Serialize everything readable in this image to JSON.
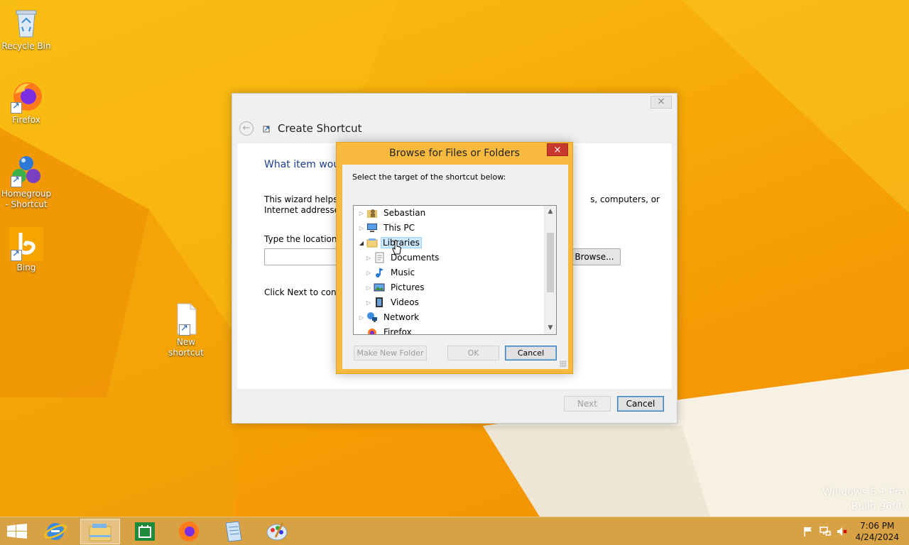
{
  "desktop": {
    "icons": [
      {
        "label": "Recycle Bin"
      },
      {
        "label": "Firefox"
      },
      {
        "label": "Homegroup - Shortcut"
      },
      {
        "label": "Bing"
      },
      {
        "label": "New shortcut"
      }
    ],
    "watermark": {
      "line1": "Windows 8.1 Pro",
      "line2": "Build 9600"
    }
  },
  "wizard": {
    "title": "Create Shortcut",
    "close_label": "×",
    "back_label": "←",
    "question": "What item wou",
    "intro": "This wizard helps yo                                                                          s, computers, or Internet addresses.",
    "intro_line1_left": "This wizard helps yo",
    "intro_line1_right": "s, computers, or",
    "intro_line2": "Internet addresses.",
    "location_label": "Type the location o",
    "location_value": "",
    "browse_label": "Browse...",
    "next_hint": "Click Next to contin",
    "next_label": "Next",
    "cancel_label": "Cancel"
  },
  "browse_dialog": {
    "title": "Browse for Files or Folders",
    "close_label": "×",
    "prompt": "Select the target of the shortcut below:",
    "tree": [
      {
        "label": "Sebastian",
        "icon": "user-folder-icon",
        "expanded": false,
        "level": 0
      },
      {
        "label": "This PC",
        "icon": "computer-icon",
        "expanded": false,
        "level": 0
      },
      {
        "label": "Libraries",
        "icon": "libraries-icon",
        "expanded": true,
        "level": 0,
        "selected": true
      },
      {
        "label": "Documents",
        "icon": "documents-icon",
        "expanded": false,
        "level": 1
      },
      {
        "label": "Music",
        "icon": "music-icon",
        "expanded": false,
        "level": 1
      },
      {
        "label": "Pictures",
        "icon": "pictures-icon",
        "expanded": false,
        "level": 1
      },
      {
        "label": "Videos",
        "icon": "videos-icon",
        "expanded": false,
        "level": 1
      },
      {
        "label": "Network",
        "icon": "network-icon",
        "expanded": false,
        "level": 0
      },
      {
        "label": "Firefox",
        "icon": "firefox-icon",
        "expanded": false,
        "level": 0
      }
    ],
    "make_folder_label": "Make New Folder",
    "ok_label": "OK",
    "cancel_label": "Cancel"
  },
  "taskbar": {
    "apps": [
      "start-button",
      "internet-explorer",
      "file-explorer",
      "store",
      "firefox",
      "document-viewer",
      "paint"
    ],
    "clock_time": "7:06 PM",
    "clock_date": "4/24/2024"
  },
  "colors": {
    "wallpaper": "#f7ab06",
    "dialog_frame": "#f7b93e",
    "close_red": "#c7392c",
    "heading_blue": "#1c3e8a",
    "selection": "#cce8ff"
  }
}
